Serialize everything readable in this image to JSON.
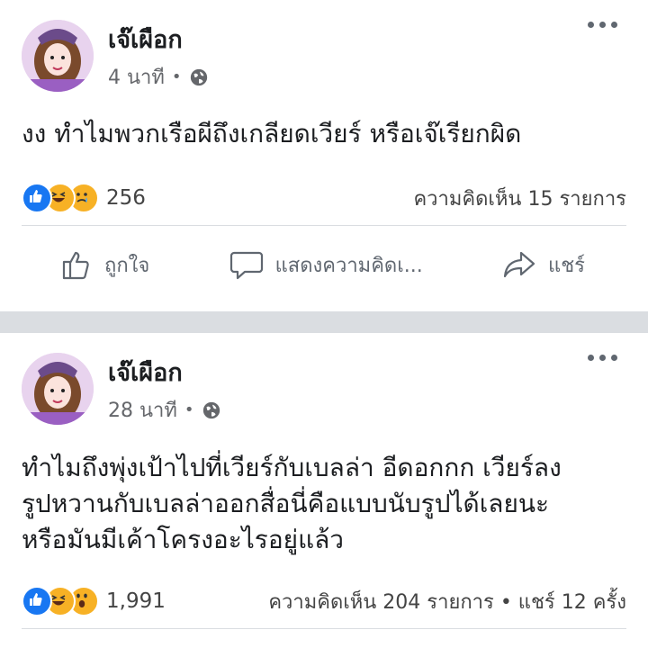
{
  "posts": [
    {
      "author": "เจ๊เผือก",
      "time": "4 นาที",
      "text": "งง ทำไมพวกเรือผีถึงเกลียดเวียร์ หรือเจ๊เรียกผิด",
      "reactions": [
        "like",
        "haha",
        "sad"
      ],
      "reaction_count": "256",
      "comments": "ความคิดเห็น 15 รายการ",
      "actions": {
        "like": "ถูกใจ",
        "comment": "แสดงความคิดเ...",
        "share": "แชร์"
      }
    },
    {
      "author": "เจ๊เผือก",
      "time": "28 นาที",
      "text": "ทำไมถึงพุ่งเป้าไปที่เวียร์กับเบลล่า อีดอกกก เวียร์ลง\nรูปหวานกับเบลล่าออกสื่อนี่คือแบบนับรูปได้เลยนะ\nหรือมันมีเค้าโครงอะไรอยู่แล้ว",
      "reactions": [
        "like",
        "haha",
        "wow"
      ],
      "reaction_count": "1,991",
      "comments": "ความคิดเห็น 204 รายการ • แชร์ 12 ครั้ง"
    }
  ],
  "colors": {
    "like": "#1877f2",
    "haha": "#f7b125",
    "sad_wow": "#f7b125",
    "secondary_text": "#65676b",
    "separator": "#dadde1"
  },
  "icons": [
    "globe-icon",
    "more-icon",
    "like-icon",
    "comment-icon",
    "share-icon"
  ]
}
